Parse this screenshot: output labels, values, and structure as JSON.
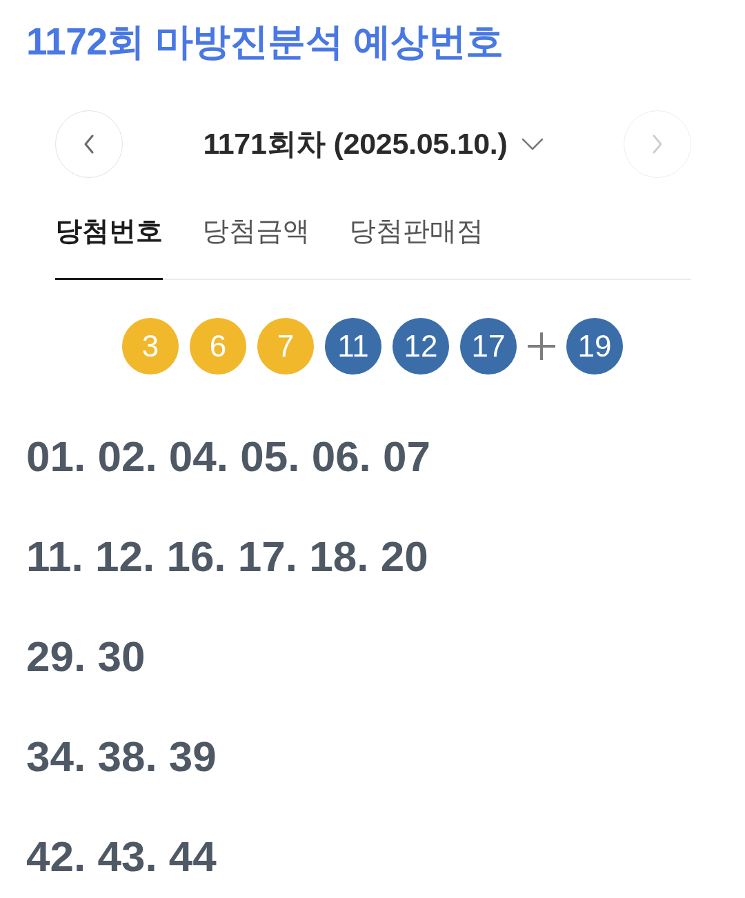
{
  "title": "1172회 마방진분석 예상번호",
  "draw_nav": {
    "prev": {
      "disabled": false
    },
    "label": "1171회차 (2025.05.10.)",
    "next": {
      "disabled": true
    }
  },
  "tabs": [
    {
      "label": "당첨번호",
      "selected": true
    },
    {
      "label": "당첨금액",
      "selected": false
    },
    {
      "label": "당첨판매점",
      "selected": false
    }
  ],
  "balls": [
    {
      "number": "3",
      "color": "#f1b82c"
    },
    {
      "number": "6",
      "color": "#f1b82c"
    },
    {
      "number": "7",
      "color": "#f1b82c"
    },
    {
      "number": "11",
      "color": "#3b6ea9"
    },
    {
      "number": "12",
      "color": "#3b6ea9"
    },
    {
      "number": "17",
      "color": "#3b6ea9"
    }
  ],
  "bonus_ball": {
    "number": "19",
    "color": "#3b6ea9"
  },
  "predictions": [
    "01. 02. 04. 05. 06. 07",
    "11. 12. 16. 17. 18. 20",
    "29. 30",
    "34. 38. 39",
    "42. 43. 44"
  ]
}
